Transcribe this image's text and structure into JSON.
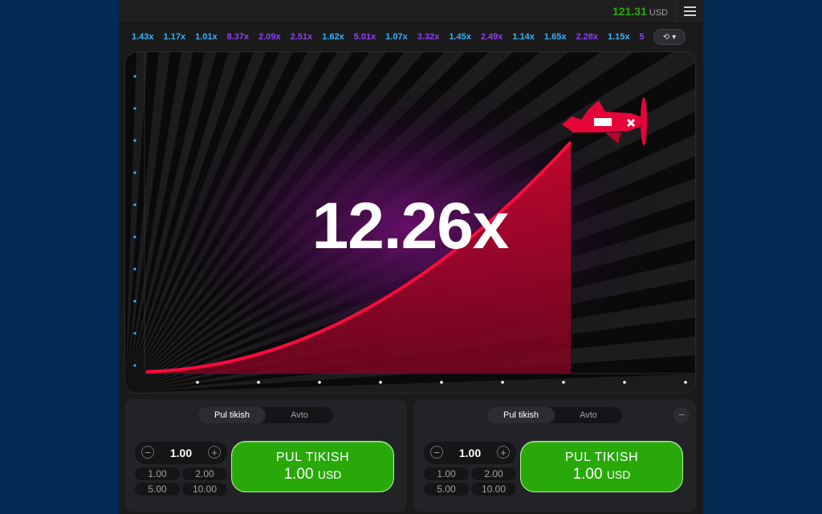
{
  "balance": {
    "amount": "121.31",
    "currency": "USD"
  },
  "history": [
    {
      "v": "1.43x",
      "c": "blue"
    },
    {
      "v": "1.17x",
      "c": "blue"
    },
    {
      "v": "1.01x",
      "c": "blue"
    },
    {
      "v": "8.37x",
      "c": "purple"
    },
    {
      "v": "2.09x",
      "c": "purple"
    },
    {
      "v": "2.51x",
      "c": "purple"
    },
    {
      "v": "1.62x",
      "c": "blue"
    },
    {
      "v": "5.01x",
      "c": "purple"
    },
    {
      "v": "1.07x",
      "c": "blue"
    },
    {
      "v": "3.32x",
      "c": "purple"
    },
    {
      "v": "1.45x",
      "c": "blue"
    },
    {
      "v": "2.49x",
      "c": "purple"
    },
    {
      "v": "1.14x",
      "c": "blue"
    },
    {
      "v": "1.65x",
      "c": "blue"
    },
    {
      "v": "2.28x",
      "c": "purple"
    },
    {
      "v": "1.15x",
      "c": "blue"
    },
    {
      "v": "5",
      "c": "purple"
    }
  ],
  "game": {
    "multiplier": "12.26x"
  },
  "colors": {
    "accent_green": "#28a909",
    "curve_red": "#e50539",
    "history_blue": "#34b4ff",
    "history_purple": "#913ef8"
  },
  "panels": [
    {
      "tabs": [
        "Pul tikish",
        "Avto"
      ],
      "stake": "1.00",
      "quick": [
        "1.00",
        "2.00",
        "5.00",
        "10.00"
      ],
      "button_line1": "PUL TIKISH",
      "button_amount": "1.00",
      "button_currency": "USD"
    },
    {
      "tabs": [
        "Pul tikish",
        "Avto"
      ],
      "stake": "1.00",
      "quick": [
        "1.00",
        "2.00",
        "5.00",
        "10.00"
      ],
      "button_line1": "PUL TIKISH",
      "button_amount": "1.00",
      "button_currency": "USD",
      "remove_icon": "minus-icon"
    }
  ]
}
